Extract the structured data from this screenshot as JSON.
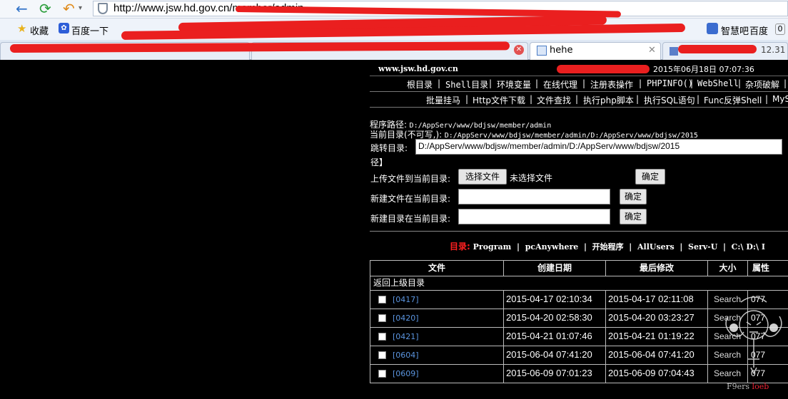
{
  "browser": {
    "url": "http://www.jsw.hd.gov.cn/member/admin",
    "favorites": {
      "shoucang": "收藏",
      "baidu": "百度一下",
      "zhidao": "智慧吧",
      "baidu2": "百度",
      "badge": "0"
    },
    "active_tab_title": "hehe",
    "tab4_text": "12.31"
  },
  "shell": {
    "site_domain": "www.jsw.hd.gov.cn",
    "datetime": "2015年06月18日 07:07:36",
    "menu_row_1": [
      "根目录",
      "Shell目录",
      "环境变量",
      "在线代理",
      "注册表操作",
      "PHPINFO()",
      "WebShell",
      "杂项破解"
    ],
    "menu_row_2": [
      "批量挂马",
      "Http文件下载",
      "文件查找",
      "执行php脚本",
      "执行SQL语句",
      "Func反弹Shell",
      "MySQ"
    ],
    "program_path_label": "程序路径:",
    "program_path": "D:/AppServ/www/bdjsw/member/admin",
    "current_dir_label": "当前目录(不可写,):",
    "current_dir": "D:/AppServ/www/bdjsw/member/admin/D:/AppServ/www/bdjsw/2015",
    "jump_label": "跳转目录:",
    "jump_value": "D:/AppServ/www/bdjsw/member/admin/D:/AppServ/www/bdjsw/2015",
    "path_tail": "径】",
    "upload_label": "上传文件到当前目录:",
    "choose_file_button": "选择文件",
    "no_file_text": "未选择文件",
    "confirm_label": "确定",
    "new_file_label": "新建文件在当前目录:",
    "new_dir_label": "新建目录在当前目录:",
    "drives_label": "目录:",
    "drives": [
      "Program",
      "pcAnywhere",
      "开始程序",
      "AllUsers",
      "Serv-U",
      "C:\\",
      "D:\\",
      "I"
    ],
    "table": {
      "headers": [
        "文件",
        "创建日期",
        "最后修改",
        "大小",
        "属性"
      ],
      "parent_dir": "返回上级目录",
      "rows": [
        {
          "name": "[0417]",
          "created": "2015-04-17 02:10:34",
          "modified": "2015-04-17 02:11:08",
          "size": "Search",
          "attr": "077"
        },
        {
          "name": "[0420]",
          "created": "2015-04-20 02:58:30",
          "modified": "2015-04-20 03:23:27",
          "size": "Search",
          "attr": "077"
        },
        {
          "name": "[0421]",
          "created": "2015-04-21 01:07:46",
          "modified": "2015-04-21 01:19:22",
          "size": "Search",
          "attr": "077"
        },
        {
          "name": "[0604]",
          "created": "2015-06-04 07:41:20",
          "modified": "2015-06-04 07:41:20",
          "size": "Search",
          "attr": "077"
        },
        {
          "name": "[0609]",
          "created": "2015-06-09 07:01:23",
          "modified": "2015-06-09 07:04:43",
          "size": "Search",
          "attr": "077"
        }
      ]
    },
    "watermark": {
      "text": "F9ers",
      "red": "loeb"
    }
  }
}
